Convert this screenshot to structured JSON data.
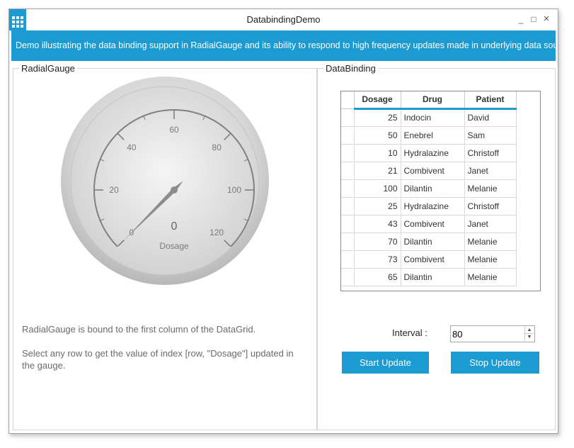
{
  "window": {
    "title": "DatabindingDemo",
    "minimize": "_",
    "maximize": "□",
    "close": "×"
  },
  "banner": {
    "text": "Demo illustrating the data binding support in RadialGauge and its ability to respond to high frequency updates made in underlying data source"
  },
  "gauge_panel": {
    "header": "RadialGauge",
    "gauge": {
      "min": 0,
      "max": 120,
      "value": 0,
      "value_text": "0",
      "label": "Dosage",
      "ticks": [
        "0",
        "20",
        "40",
        "60",
        "80",
        "100",
        "120"
      ]
    },
    "desc1": "RadialGauge is bound to the first column of the DataGrid.",
    "desc2": "Select any row to get the value of index [row, \"Dosage\"] updated in the gauge."
  },
  "binding_panel": {
    "header": "DataBinding",
    "grid": {
      "columns": [
        "Dosage",
        "Drug",
        "Patient"
      ],
      "rows": [
        {
          "dosage": "25",
          "drug": "Indocin",
          "patient": "David"
        },
        {
          "dosage": "50",
          "drug": "Enebrel",
          "patient": "Sam"
        },
        {
          "dosage": "10",
          "drug": "Hydralazine",
          "patient": "Christoff"
        },
        {
          "dosage": "21",
          "drug": "Combivent",
          "patient": "Janet"
        },
        {
          "dosage": "100",
          "drug": "Dilantin",
          "patient": "Melanie"
        },
        {
          "dosage": "25",
          "drug": "Hydralazine",
          "patient": "Christoff"
        },
        {
          "dosage": "43",
          "drug": "Combivent",
          "patient": "Janet"
        },
        {
          "dosage": "70",
          "drug": "Dilantin",
          "patient": "Melanie"
        },
        {
          "dosage": "73",
          "drug": "Combivent",
          "patient": "Melanie"
        },
        {
          "dosage": "65",
          "drug": "Dilantin",
          "patient": "Melanie"
        }
      ]
    },
    "interval_label": "Interval :",
    "interval_value": "80",
    "start_button": "Start Update",
    "stop_button": "Stop Update"
  },
  "colors": {
    "accent": "#1b9bd1"
  }
}
